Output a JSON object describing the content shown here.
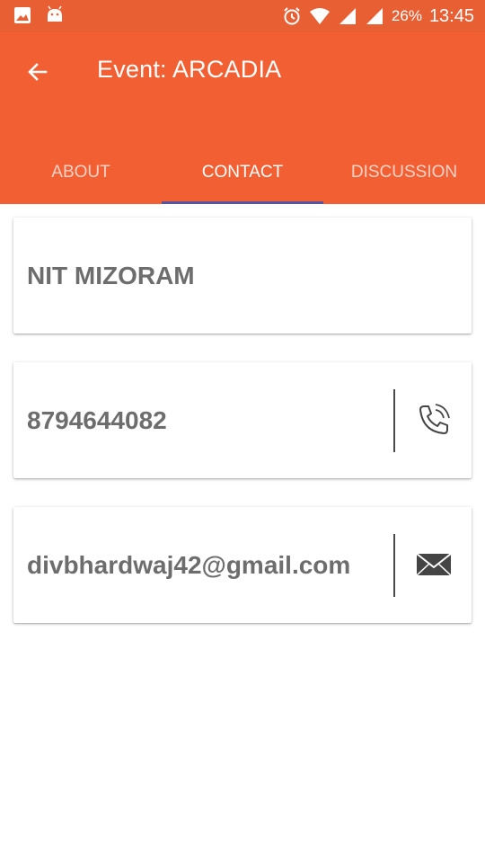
{
  "status_bar": {
    "icons_left": [
      "image-icon",
      "android-icon"
    ],
    "icons_right": [
      "alarm-icon",
      "wifi-icon",
      "signal-icon",
      "signal-icon-2"
    ],
    "battery": "26%",
    "time": "13:45"
  },
  "app_bar": {
    "title": "Event: ARCADIA",
    "back_icon": "arrow-back-icon",
    "color": "#f15f33"
  },
  "tabs": [
    {
      "label": "ABOUT",
      "active": false
    },
    {
      "label": "CONTACT",
      "active": true
    },
    {
      "label": "DISCUSSION",
      "active": false
    }
  ],
  "contact": {
    "organization": "NIT MIZORAM",
    "phone": "8794644082",
    "phone_icon": "phone-icon",
    "email": "divbhardwaj42@gmail.com",
    "email_icon": "mail-icon"
  },
  "colors": {
    "accent": "#f15f33",
    "status_bar": "#e85f34",
    "tab_indicator": "#3f51b5",
    "card_text": "#6d6d6d"
  }
}
